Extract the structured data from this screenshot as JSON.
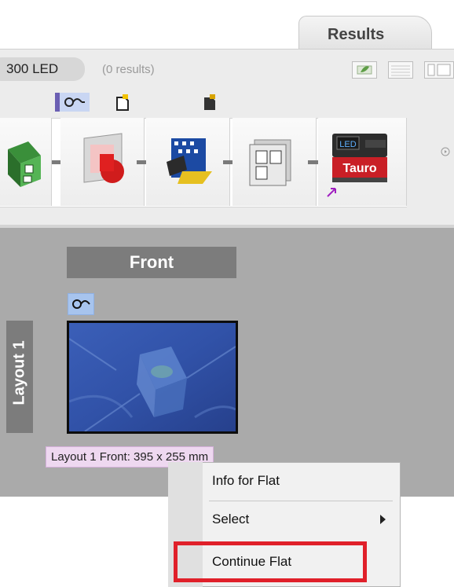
{
  "tabs": {
    "results_label": "Results"
  },
  "toolbar": {
    "device_label": "300 LED",
    "results_count": "(0 results)"
  },
  "workflow": {
    "steps": [
      {
        "icon": "recycle-boxes-icon"
      },
      {
        "icon": "screen-separation-icon"
      },
      {
        "icon": "halftone-output-icon"
      },
      {
        "icon": "layout-imposition-icon"
      },
      {
        "icon": "tauro-printer-icon",
        "brand_label": "Tauro",
        "led_label": "LED"
      }
    ]
  },
  "layout": {
    "side_label": "Layout 1",
    "front_label": "Front",
    "caption": "Layout 1 Front: 395 x 255 mm"
  },
  "context_menu": {
    "items": [
      {
        "label": "Info for Flat"
      },
      {
        "label": "Select"
      },
      {
        "label": "Continue Flat"
      }
    ]
  },
  "colors": {
    "highlight": "#e0202a",
    "workspace": "#aaaaaa",
    "header_gray": "#7c7c7c",
    "caption_bg": "#eed8f0"
  }
}
